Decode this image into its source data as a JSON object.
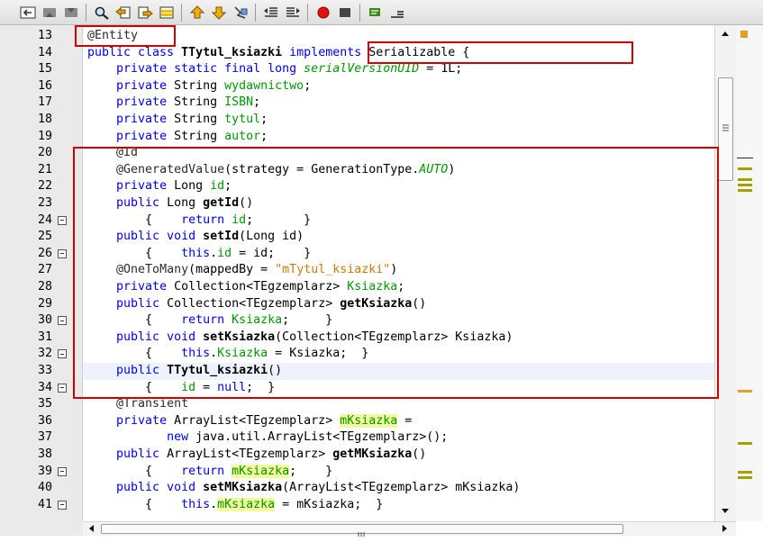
{
  "toolbar": {
    "buttons": [
      {
        "icon": "back-history-icon"
      },
      {
        "icon": "previous-edit-icon"
      },
      {
        "icon": "next-edit-icon"
      },
      {
        "icon": "find-icon"
      },
      {
        "icon": "find-previous-icon"
      },
      {
        "icon": "find-next-icon"
      },
      {
        "icon": "toggle-highlight-icon"
      },
      {
        "icon": "previous-bookmark-icon"
      },
      {
        "icon": "next-bookmark-icon"
      },
      {
        "icon": "toggle-bookmark-icon"
      },
      {
        "icon": "shift-left-icon"
      },
      {
        "icon": "shift-right-icon"
      },
      {
        "icon": "start-macro-icon"
      },
      {
        "icon": "stop-macro-icon"
      },
      {
        "icon": "comment-icon"
      },
      {
        "icon": "uncomment-icon"
      }
    ]
  },
  "editor": {
    "current_line": 33,
    "lines": [
      {
        "n": "13",
        "fold": false,
        "tokens": [
          {
            "t": "@Entity",
            "c": "an"
          }
        ]
      },
      {
        "n": "14",
        "fold": false,
        "tokens": [
          {
            "t": "public class ",
            "c": "kw"
          },
          {
            "t": "TTytul_ksiazki",
            "c": "mt"
          },
          {
            "t": " "
          },
          {
            "t": "implements",
            "c": "kw"
          },
          {
            "t": " Serializable {"
          }
        ]
      },
      {
        "n": "15",
        "fold": false,
        "tokens": [
          {
            "t": "    "
          },
          {
            "t": "private static final long ",
            "c": "kw"
          },
          {
            "t": "serialVersionUID",
            "c": "fldi"
          },
          {
            "t": " = 1L;"
          }
        ]
      },
      {
        "n": "16",
        "fold": false,
        "tokens": [
          {
            "t": "    "
          },
          {
            "t": "private ",
            "c": "kw"
          },
          {
            "t": "String "
          },
          {
            "t": "wydawnictwo",
            "c": "fld"
          },
          {
            "t": ";"
          }
        ]
      },
      {
        "n": "17",
        "fold": false,
        "tokens": [
          {
            "t": "    "
          },
          {
            "t": "private ",
            "c": "kw"
          },
          {
            "t": "String "
          },
          {
            "t": "ISBN",
            "c": "fld"
          },
          {
            "t": ";"
          }
        ]
      },
      {
        "n": "18",
        "fold": false,
        "tokens": [
          {
            "t": "    "
          },
          {
            "t": "private ",
            "c": "kw"
          },
          {
            "t": "String "
          },
          {
            "t": "tytul",
            "c": "fld"
          },
          {
            "t": ";"
          }
        ]
      },
      {
        "n": "19",
        "fold": false,
        "tokens": [
          {
            "t": "    "
          },
          {
            "t": "private ",
            "c": "kw"
          },
          {
            "t": "String "
          },
          {
            "t": "autor",
            "c": "fld"
          },
          {
            "t": ";"
          }
        ]
      },
      {
        "n": "20",
        "fold": false,
        "tokens": [
          {
            "t": "    "
          },
          {
            "t": "@Id",
            "c": "an"
          }
        ]
      },
      {
        "n": "21",
        "fold": false,
        "tokens": [
          {
            "t": "    "
          },
          {
            "t": "@GeneratedValue",
            "c": "an"
          },
          {
            "t": "(strategy = GenerationType."
          },
          {
            "t": "AUTO",
            "c": "fldi"
          },
          {
            "t": ")"
          }
        ]
      },
      {
        "n": "22",
        "fold": false,
        "tokens": [
          {
            "t": "    "
          },
          {
            "t": "private ",
            "c": "kw"
          },
          {
            "t": "Long "
          },
          {
            "t": "id",
            "c": "fld"
          },
          {
            "t": ";"
          }
        ]
      },
      {
        "n": "23",
        "fold": false,
        "tokens": [
          {
            "t": "    "
          },
          {
            "t": "public ",
            "c": "kw"
          },
          {
            "t": "Long "
          },
          {
            "t": "getId",
            "c": "mt"
          },
          {
            "t": "()"
          }
        ]
      },
      {
        "n": "24",
        "fold": true,
        "tokens": [
          {
            "t": "        {    "
          },
          {
            "t": "return ",
            "c": "kw"
          },
          {
            "t": "id",
            "c": "fld"
          },
          {
            "t": ";       }"
          }
        ]
      },
      {
        "n": "25",
        "fold": false,
        "tokens": [
          {
            "t": "    "
          },
          {
            "t": "public void ",
            "c": "kw"
          },
          {
            "t": "setId",
            "c": "mt"
          },
          {
            "t": "(Long id)"
          }
        ]
      },
      {
        "n": "26",
        "fold": true,
        "tokens": [
          {
            "t": "        {    "
          },
          {
            "t": "this",
            "c": "kw"
          },
          {
            "t": "."
          },
          {
            "t": "id",
            "c": "fld"
          },
          {
            "t": " = id;    }"
          }
        ]
      },
      {
        "n": "27",
        "fold": false,
        "tokens": [
          {
            "t": "    "
          },
          {
            "t": "@OneToMany",
            "c": "an"
          },
          {
            "t": "(mappedBy = "
          },
          {
            "t": "\"mTytul_ksiazki\"",
            "c": "st"
          },
          {
            "t": ")"
          }
        ]
      },
      {
        "n": "28",
        "fold": false,
        "tokens": [
          {
            "t": "    "
          },
          {
            "t": "private ",
            "c": "kw"
          },
          {
            "t": "Collection<TEgzemplarz> "
          },
          {
            "t": "Ksiazka",
            "c": "fld"
          },
          {
            "t": ";"
          }
        ]
      },
      {
        "n": "29",
        "fold": false,
        "tokens": [
          {
            "t": "    "
          },
          {
            "t": "public ",
            "c": "kw"
          },
          {
            "t": "Collection<TEgzemplarz> "
          },
          {
            "t": "getKsiazka",
            "c": "mt"
          },
          {
            "t": "()"
          }
        ]
      },
      {
        "n": "30",
        "fold": true,
        "tokens": [
          {
            "t": "        {    "
          },
          {
            "t": "return ",
            "c": "kw"
          },
          {
            "t": "Ksiazka",
            "c": "fld"
          },
          {
            "t": ";     }"
          }
        ]
      },
      {
        "n": "31",
        "fold": false,
        "tokens": [
          {
            "t": "    "
          },
          {
            "t": "public void ",
            "c": "kw"
          },
          {
            "t": "setKsiazka",
            "c": "mt"
          },
          {
            "t": "(Collection<TEgzemplarz> Ksiazka)"
          }
        ]
      },
      {
        "n": "32",
        "fold": true,
        "tokens": [
          {
            "t": "        {    "
          },
          {
            "t": "this",
            "c": "kw"
          },
          {
            "t": "."
          },
          {
            "t": "Ksiazka",
            "c": "fld"
          },
          {
            "t": " = Ksiazka;  }"
          }
        ]
      },
      {
        "n": "33",
        "fold": false,
        "tokens": [
          {
            "t": "    "
          },
          {
            "t": "public ",
            "c": "kw"
          },
          {
            "t": "TTytul_ksiazki",
            "c": "mt"
          },
          {
            "t": "()"
          }
        ]
      },
      {
        "n": "34",
        "fold": true,
        "tokens": [
          {
            "t": "        {    "
          },
          {
            "t": "id",
            "c": "fld"
          },
          {
            "t": " = "
          },
          {
            "t": "null",
            "c": "kw"
          },
          {
            "t": ";  }"
          }
        ]
      },
      {
        "n": "35",
        "fold": false,
        "tokens": [
          {
            "t": "    "
          },
          {
            "t": "@Transient",
            "c": "an"
          }
        ]
      },
      {
        "n": "36",
        "fold": false,
        "tokens": [
          {
            "t": "    "
          },
          {
            "t": "private ",
            "c": "kw"
          },
          {
            "t": "ArrayList<TEgzemplarz> "
          },
          {
            "t": "mKsiazka",
            "c": "hl"
          },
          {
            "t": " ="
          }
        ]
      },
      {
        "n": "37",
        "fold": false,
        "tokens": [
          {
            "t": "           "
          },
          {
            "t": "new ",
            "c": "kw"
          },
          {
            "t": "java.util.ArrayList<TEgzemplarz>();"
          }
        ]
      },
      {
        "n": "38",
        "fold": false,
        "tokens": [
          {
            "t": "    "
          },
          {
            "t": "public ",
            "c": "kw"
          },
          {
            "t": "ArrayList<TEgzemplarz> "
          },
          {
            "t": "getMKsiazka",
            "c": "mt"
          },
          {
            "t": "()"
          }
        ]
      },
      {
        "n": "39",
        "fold": true,
        "tokens": [
          {
            "t": "        {    "
          },
          {
            "t": "return ",
            "c": "kw"
          },
          {
            "t": "mKsiazka",
            "c": "hl"
          },
          {
            "t": ";    }"
          }
        ]
      },
      {
        "n": "40",
        "fold": false,
        "tokens": [
          {
            "t": "    "
          },
          {
            "t": "public void ",
            "c": "kw"
          },
          {
            "t": "setMKsiazka",
            "c": "mt"
          },
          {
            "t": "(ArrayList<TEgzemplarz> mKsiazka)"
          }
        ]
      },
      {
        "n": "41",
        "fold": true,
        "tokens": [
          {
            "t": "        {    "
          },
          {
            "t": "this",
            "c": "kw"
          },
          {
            "t": "."
          },
          {
            "t": "mKsiazka",
            "c": "hl"
          },
          {
            "t": " = mKsiazka;  }"
          }
        ]
      }
    ]
  },
  "colors": {
    "keyword": "#0000e6",
    "field": "#009900",
    "string": "#ce7b00",
    "highlight": "#f4f99e",
    "callout": "#d40000",
    "current_line": "#eef3fb",
    "marker_warning": "#e0a020",
    "marker_change": "#a8a000"
  }
}
